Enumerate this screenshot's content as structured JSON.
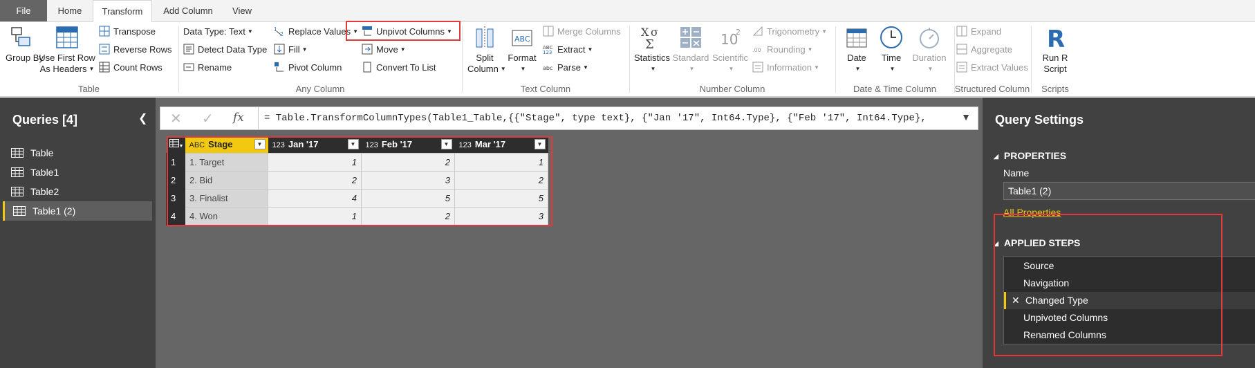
{
  "ribbon_tabs": [
    "File",
    "Home",
    "Transform",
    "Add Column",
    "View"
  ],
  "table_group": {
    "group_by": "Group By",
    "use_first_row_1": "Use First Row",
    "use_first_row_2": "As Headers",
    "transpose": "Transpose",
    "reverse_rows": "Reverse Rows",
    "count_rows": "Count Rows",
    "label": "Table"
  },
  "any_column_group": {
    "data_type": "Data Type: Text",
    "detect_data_type": "Detect Data Type",
    "rename": "Rename",
    "replace_values": "Replace Values",
    "fill": "Fill",
    "pivot_column": "Pivot Column",
    "unpivot_columns": "Unpivot Columns",
    "move": "Move",
    "convert_to_list": "Convert To List",
    "label": "Any Column"
  },
  "text_column_group": {
    "split_1": "Split",
    "split_2": "Column",
    "format": "Format",
    "merge_columns": "Merge Columns",
    "extract": "Extract",
    "parse": "Parse",
    "label": "Text Column"
  },
  "number_column_group": {
    "statistics": "Statistics",
    "standard": "Standard",
    "scientific": "Scientific",
    "trigonometry": "Trigonometry",
    "rounding": "Rounding",
    "information": "Information",
    "label": "Number Column"
  },
  "datetime_group": {
    "date": "Date",
    "time": "Time",
    "duration": "Duration",
    "label": "Date & Time Column"
  },
  "structured_group": {
    "expand": "Expand",
    "aggregate": "Aggregate",
    "extract_values": "Extract Values",
    "label": "Structured Column"
  },
  "scripts_group": {
    "run_r_1": "Run R",
    "run_r_2": "Script",
    "label": "Scripts"
  },
  "queries": {
    "title": "Queries [4]",
    "items": [
      "Table",
      "Table1",
      "Table2",
      "Table1 (2)"
    ]
  },
  "formula": {
    "fx": "fx",
    "text": "= Table.TransformColumnTypes(Table1_Table,{{\"Stage\", type text}, {\"Jan '17\", Int64.Type}, {\"Feb '17\", Int64.Type},"
  },
  "grid": {
    "headers": [
      "Stage",
      "Jan '17",
      "Feb '17",
      "Mar '17"
    ],
    "type_text": "ABC",
    "type_num": "123",
    "rows": [
      [
        "1",
        "1. Target",
        "1",
        "2",
        "1"
      ],
      [
        "2",
        "2. Bid",
        "2",
        "3",
        "2"
      ],
      [
        "3",
        "3. Finalist",
        "4",
        "5",
        "5"
      ],
      [
        "4",
        "4. Won",
        "1",
        "2",
        "3"
      ]
    ]
  },
  "settings": {
    "title": "Query Settings",
    "properties": "PROPERTIES",
    "name_label": "Name",
    "name_value": "Table1 (2)",
    "all_properties": "All Properties",
    "applied_steps": "APPLIED STEPS",
    "steps": [
      "Source",
      "Navigation",
      "Changed Type",
      "Unpivoted Columns",
      "Renamed Columns"
    ]
  },
  "colors": {
    "accent": "#f2c811",
    "highlight_box": "#e03b3b",
    "pane_bg": "#414141",
    "grid_header": "#2d2d2d"
  }
}
